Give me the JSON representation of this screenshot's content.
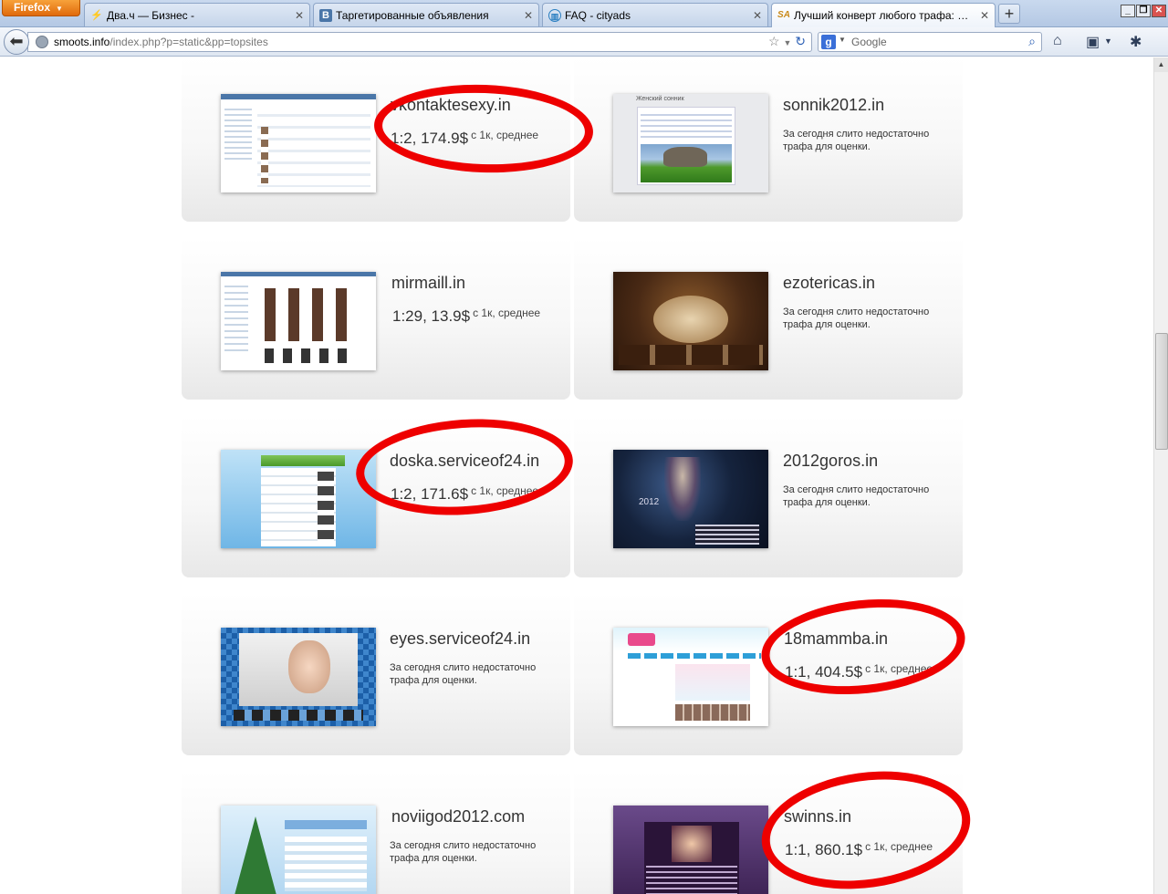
{
  "browser": {
    "app_button": "Firefox",
    "tabs": [
      {
        "title": "Два.ч — Бизнес -",
        "favicon": "lightning-icon"
      },
      {
        "title": "Таргетированные объявления",
        "favicon": "vk-icon",
        "favicon_text": "B"
      },
      {
        "title": "FAQ - cityads",
        "favicon": "chart-icon"
      },
      {
        "title": "Лучший конверт любого трафа: Smoots",
        "favicon": "sa-icon",
        "favicon_text": "SA",
        "active": true
      }
    ],
    "url_host": "smoots.info",
    "url_path": "/index.php?p=static&pp=topsites",
    "search_placeholder": "Google"
  },
  "sites": [
    {
      "name": "vkontaktesexy.in",
      "rate": "1:2, 174.9$",
      "rate_sub": "с 1к, среднее"
    },
    {
      "name": "sonnik2012.in",
      "note": "За сегодня слито недостаточно трафа для оценки."
    },
    {
      "name": "mirmaill.in",
      "rate": "1:29, 13.9$",
      "rate_sub": "с 1к, среднее"
    },
    {
      "name": "ezotericas.in",
      "note": "За сегодня слито недостаточно трафа для оценки."
    },
    {
      "name": "doska.serviceof24.in",
      "rate": "1:2, 171.6$",
      "rate_sub": "с 1к, среднее"
    },
    {
      "name": "2012goros.in",
      "note": "За сегодня слито недостаточно трафа для оценки."
    },
    {
      "name": "eyes.serviceof24.in",
      "note": "За сегодня слито недостаточно трафа для оценки."
    },
    {
      "name": "18mammba.in",
      "rate": "1:1, 404.5$",
      "rate_sub": "с 1к, среднее"
    },
    {
      "name": "noviigod2012.com",
      "note": "За сегодня слито недостаточно трафа для оценки."
    },
    {
      "name": "swinns.in",
      "rate": "1:1, 860.1$",
      "rate_sub": "с 1к, среднее"
    }
  ],
  "thumbnails": {
    "2": "2012",
    "1_title": "Женский сонник"
  },
  "colors": {
    "annotation_circle": "#ee0000",
    "firefox_orange": "#e06a0c"
  }
}
